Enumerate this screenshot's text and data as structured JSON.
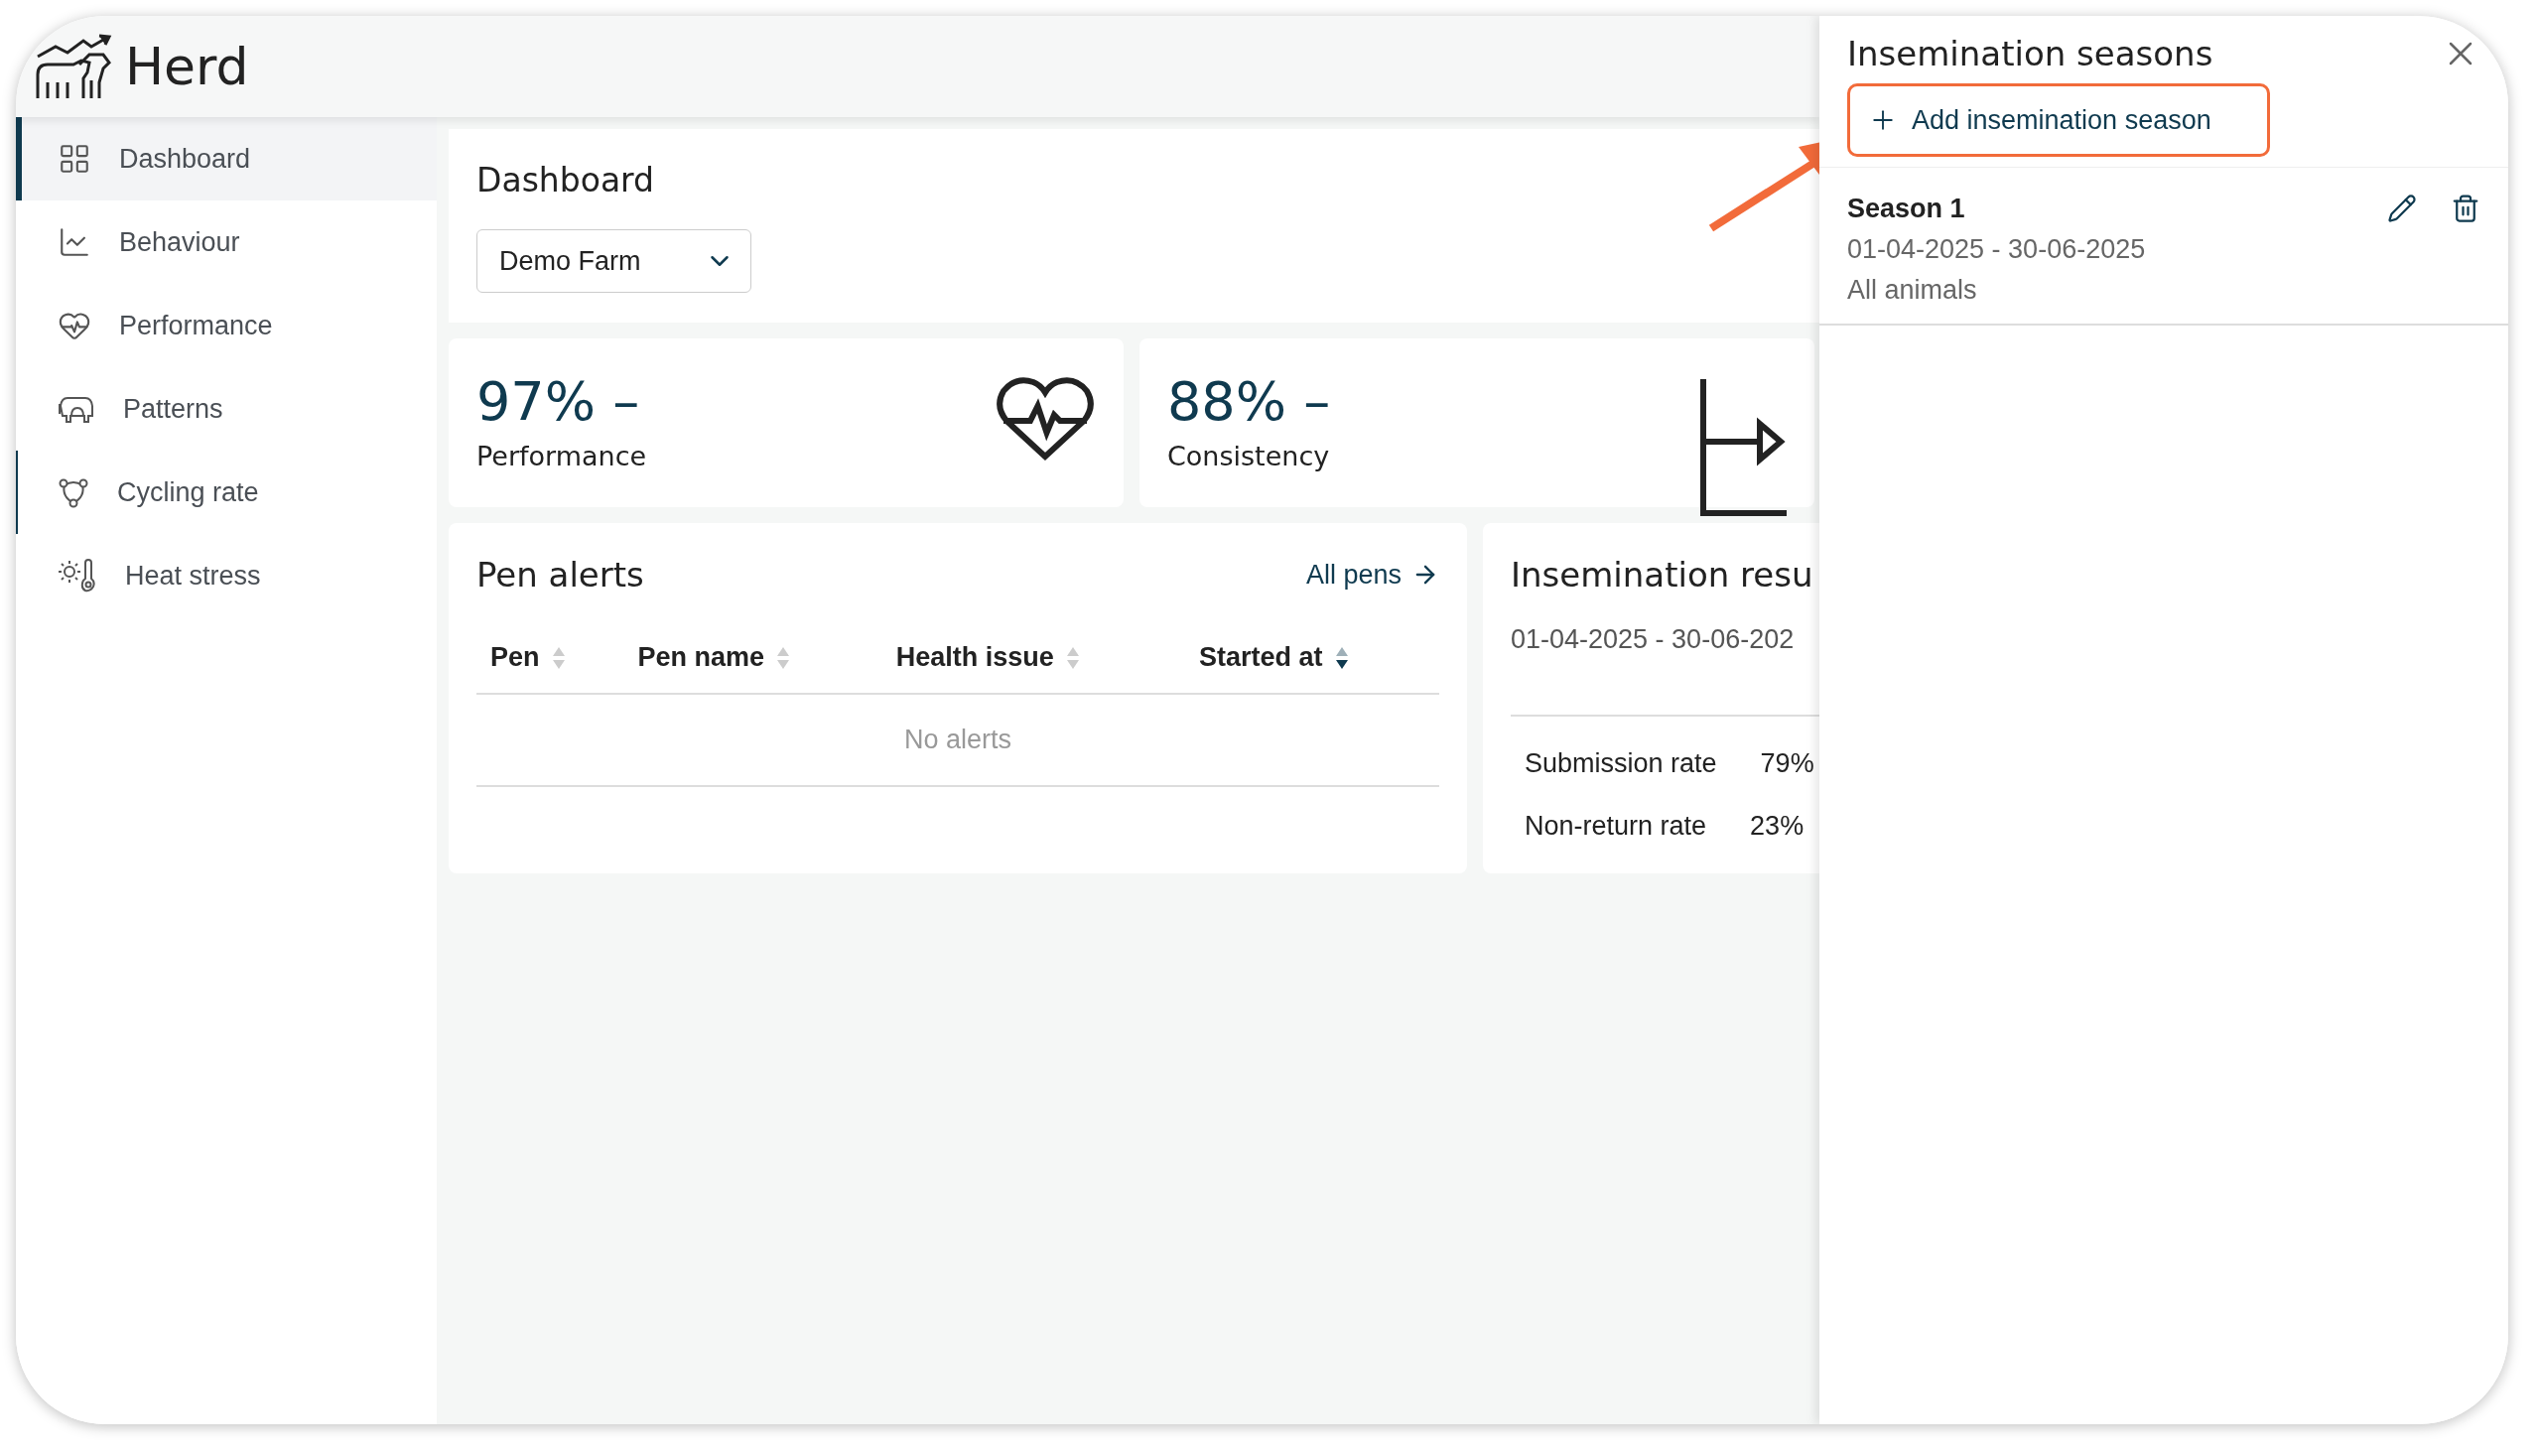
{
  "app": {
    "name": "Herd"
  },
  "sidebar": {
    "items": [
      {
        "label": "Dashboard",
        "selected": true,
        "hovered": false
      },
      {
        "label": "Behaviour",
        "selected": false,
        "hovered": false
      },
      {
        "label": "Performance",
        "selected": false,
        "hovered": false
      },
      {
        "label": "Patterns",
        "selected": false,
        "hovered": false
      },
      {
        "label": "Cycling rate",
        "selected": false,
        "hovered": true
      },
      {
        "label": "Heat stress",
        "selected": false,
        "hovered": false
      }
    ]
  },
  "page": {
    "title": "Dashboard",
    "farm_select": {
      "value": "Demo Farm"
    }
  },
  "kpis": [
    {
      "value": "97%",
      "trend": "–",
      "label": "Performance"
    },
    {
      "value": "88%",
      "trend": "–",
      "label": "Consistency"
    }
  ],
  "pen_alerts": {
    "title": "Pen alerts",
    "link": "All pens",
    "columns": [
      {
        "label": "Pen",
        "sorted": false
      },
      {
        "label": "Pen name",
        "sorted": false
      },
      {
        "label": "Health issue",
        "sorted": false
      },
      {
        "label": "Started at",
        "sorted": true
      }
    ],
    "empty_text": "No alerts"
  },
  "insemination_results": {
    "title": "Insemination resu",
    "period": "01-04-2025 - 30-06-202",
    "rows": [
      {
        "label": "Submission rate",
        "value": "79%"
      },
      {
        "label": "Non-return rate",
        "value": "23%"
      }
    ]
  },
  "drawer": {
    "title": "Insemination seasons",
    "add_button": "Add insemination season",
    "seasons": [
      {
        "name": "Season 1",
        "period": "01-04-2025 - 30-06-2025",
        "scope": "All animals"
      }
    ]
  }
}
